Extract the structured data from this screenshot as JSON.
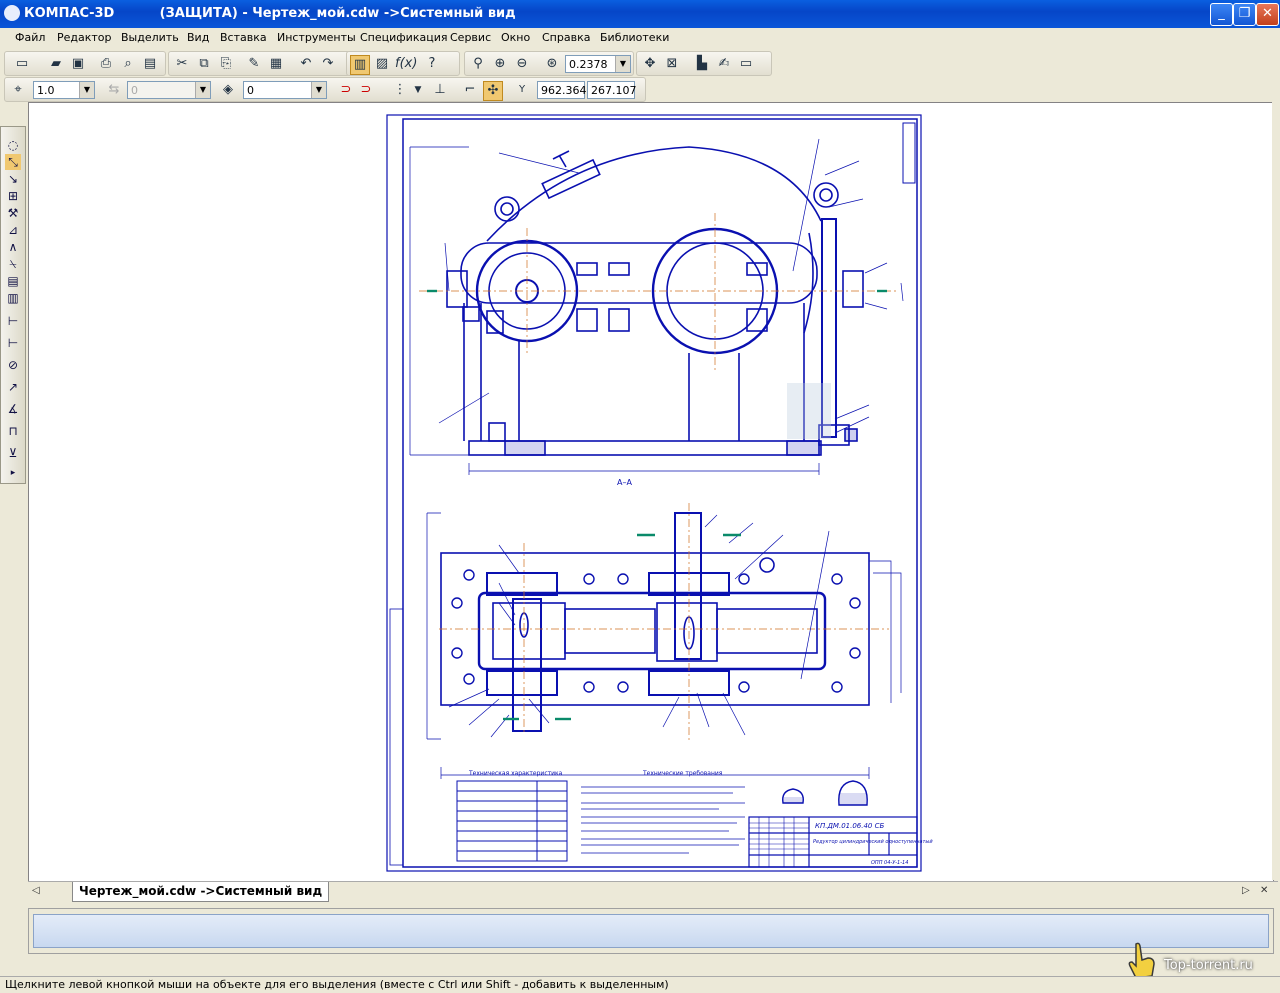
{
  "window": {
    "title": "КОМПАС-3D          (ЗАЩИТА) - Чертеж_мой.cdw ->Системный вид",
    "min_symbol": "_",
    "max_symbol": "❐",
    "close_symbol": "✕"
  },
  "menu": [
    {
      "label": "Файл"
    },
    {
      "label": "Редактор"
    },
    {
      "label": "Выделить"
    },
    {
      "label": "Вид"
    },
    {
      "label": "Вставка"
    },
    {
      "label": "Инструменты"
    },
    {
      "label": "Спецификация"
    },
    {
      "label": "Сервис"
    },
    {
      "label": "Окно"
    },
    {
      "label": "Справка"
    },
    {
      "label": "Библиотеки"
    }
  ],
  "toolbar": {
    "zoom_value": "0.2378",
    "line_scale": "1.0",
    "style_value": "0",
    "layer_value": "0",
    "coord_x": "962.364",
    "coord_y": "267.107",
    "coord_label": "Y"
  },
  "drawing": {
    "section_label": "А–А",
    "stamp_title": "Редуктор цилиндрический одноступенчатый",
    "stamp_code": "КП.ДМ.01.06.40 СБ",
    "stamp_org": "ОПП 04-У-1-14",
    "tech_req_title": "Технические требования",
    "tech_char_title": "Техническая характеристика"
  },
  "document_tab": {
    "label": "Чертеж_мой.cdw ->Системный вид"
  },
  "status": {
    "text": "Щелкните левой кнопкой мыши на объекте для его выделения (вместе с Ctrl или Shift - добавить к выделенным)"
  },
  "watermark": {
    "text": "Top-torrent.ru"
  },
  "colors": {
    "titlebar": "#0646c8",
    "drawing_line": "#0a10b0",
    "center_line": "#d07020"
  }
}
